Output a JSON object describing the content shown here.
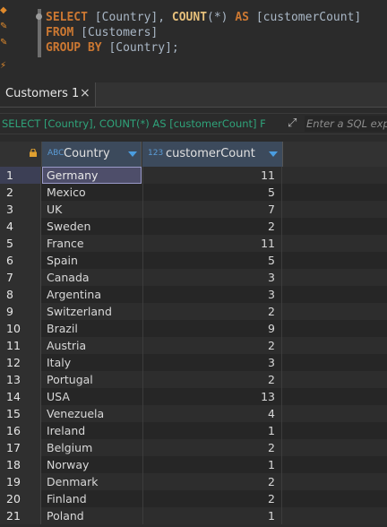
{
  "editor": {
    "lines": [
      [
        {
          "t": "SELECT",
          "k": "kw"
        },
        {
          "t": " [Country], ",
          "k": "txt"
        },
        {
          "t": "COUNT",
          "k": "fn"
        },
        {
          "t": "(*) ",
          "k": "txt"
        },
        {
          "t": "AS",
          "k": "kw"
        },
        {
          "t": " [customerCount]",
          "k": "txt"
        }
      ],
      [
        {
          "t": "FROM",
          "k": "kw"
        },
        {
          "t": " [Customers]",
          "k": "txt"
        }
      ],
      [
        {
          "t": "GROUP BY",
          "k": "kw"
        },
        {
          "t": " [Country];",
          "k": "txt"
        }
      ]
    ]
  },
  "tabs": [
    {
      "label": "Customers 1",
      "close": "×"
    }
  ],
  "filter": {
    "sql": "SELECT [Country], COUNT(*) AS [customerCount] F",
    "placeholder": "Enter a SQL expression to filter results",
    "expand_icon": "expand-icon"
  },
  "grid": {
    "columns": [
      {
        "name": "Country",
        "type_badge": "ABC"
      },
      {
        "name": "customerCount",
        "type_badge": "123"
      }
    ],
    "rows": [
      {
        "n": "1",
        "country": "Germany",
        "count": "11"
      },
      {
        "n": "2",
        "country": "Mexico",
        "count": "5"
      },
      {
        "n": "3",
        "country": "UK",
        "count": "7"
      },
      {
        "n": "4",
        "country": "Sweden",
        "count": "2"
      },
      {
        "n": "5",
        "country": "France",
        "count": "11"
      },
      {
        "n": "6",
        "country": "Spain",
        "count": "5"
      },
      {
        "n": "7",
        "country": "Canada",
        "count": "3"
      },
      {
        "n": "8",
        "country": "Argentina",
        "count": "3"
      },
      {
        "n": "9",
        "country": "Switzerland",
        "count": "2"
      },
      {
        "n": "10",
        "country": "Brazil",
        "count": "9"
      },
      {
        "n": "11",
        "country": "Austria",
        "count": "2"
      },
      {
        "n": "12",
        "country": "Italy",
        "count": "3"
      },
      {
        "n": "13",
        "country": "Portugal",
        "count": "2"
      },
      {
        "n": "14",
        "country": "USA",
        "count": "13"
      },
      {
        "n": "15",
        "country": "Venezuela",
        "count": "4"
      },
      {
        "n": "16",
        "country": "Ireland",
        "count": "1"
      },
      {
        "n": "17",
        "country": "Belgium",
        "count": "2"
      },
      {
        "n": "18",
        "country": "Norway",
        "count": "1"
      },
      {
        "n": "19",
        "country": "Denmark",
        "count": "2"
      },
      {
        "n": "20",
        "country": "Finland",
        "count": "2"
      },
      {
        "n": "21",
        "country": "Poland",
        "count": "1"
      }
    ],
    "selected_row": "1"
  },
  "colors": {
    "keyword": "#cc7832",
    "function": "#e6c07b",
    "filter_sql": "#2fa37a",
    "header_bg": "#3c4a5c",
    "sort_arrow": "#4a9de0"
  }
}
